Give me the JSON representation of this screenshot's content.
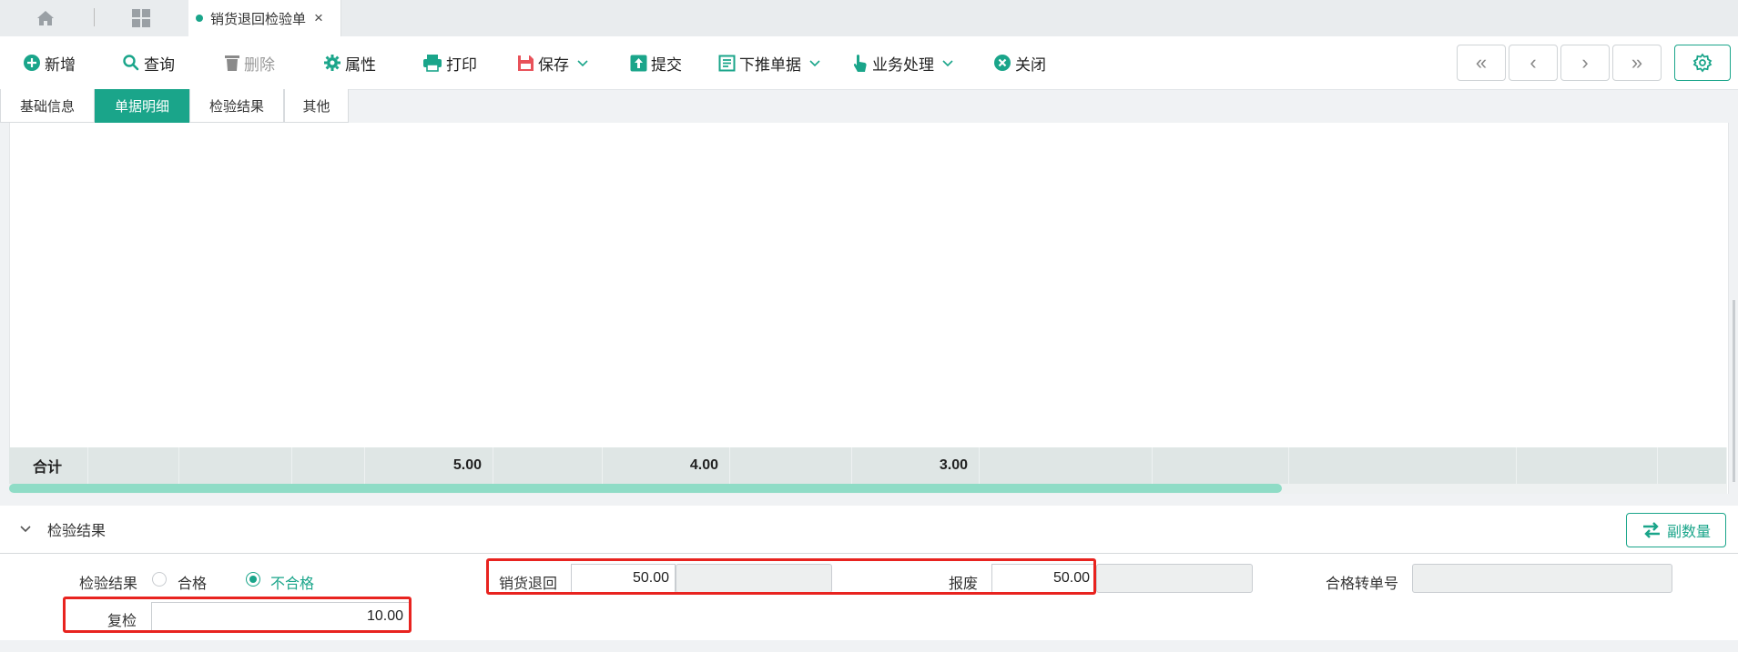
{
  "topbar": {
    "page_tab_label": "销货退回检验单",
    "close_glyph": "×"
  },
  "toolbar": {
    "items": [
      {
        "label": "新增",
        "icon": "plus-circle-icon"
      },
      {
        "label": "查询",
        "icon": "search-icon"
      },
      {
        "label": "删除",
        "icon": "trash-icon",
        "disabled": true
      },
      {
        "label": "属性",
        "icon": "gear-icon"
      },
      {
        "label": "打印",
        "icon": "printer-icon"
      },
      {
        "label": "保存",
        "icon": "save-icon",
        "dropdown": true
      },
      {
        "label": "提交",
        "icon": "upload-icon"
      },
      {
        "label": "下推单据",
        "icon": "document-icon",
        "dropdown": true
      },
      {
        "label": "业务处理",
        "icon": "hand-pointer-icon",
        "dropdown": true
      },
      {
        "label": "关闭",
        "icon": "close-circle-icon"
      }
    ],
    "nav": [
      "«",
      "‹",
      "›",
      "»"
    ]
  },
  "subtabs": [
    "基础信息",
    "单据明细",
    "检验结果",
    "其他"
  ],
  "active_subtab": "单据明细",
  "grid": {
    "sum_label": "合计",
    "sums": [
      "5.00",
      "4.00",
      "3.00"
    ]
  },
  "section": {
    "title": "检验结果",
    "button_label": "副数量"
  },
  "form": {
    "result_label": "检验结果",
    "option_pass": "合格",
    "option_fail": "不合格",
    "selected": "不合格",
    "return_label": "销货退回",
    "return_value": "50.00",
    "scrap_label": "报废",
    "scrap_value": "50.00",
    "transfer_label": "合格转单号",
    "transfer_value": "",
    "recheck_label": "复检",
    "recheck_value": "10.00"
  },
  "colors": {
    "accent": "#1aa58a",
    "highlight": "#e8231f"
  }
}
